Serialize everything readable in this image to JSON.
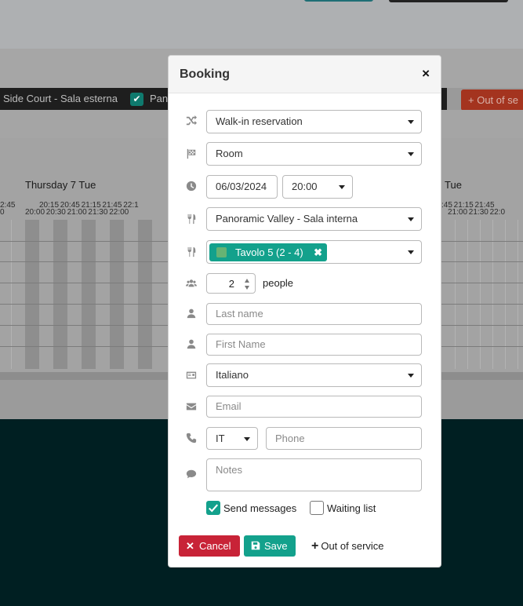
{
  "background": {
    "bar_items": [
      "Side Court - Sala esterna",
      "Pano"
    ],
    "out_of_service_button": "+ Out of se",
    "day_label_left": "Thursday 7 Tue",
    "day_label_right": "Tue",
    "times_row1_left": "2:45",
    "times_row2_left": "0",
    "times_row1": "20:15   20:45   21:15   21:45   22:1",
    "times_row2": "20:00   20:30   21:00   21:30   22:00",
    "times_right_row1": ":45   21:15   21:45",
    "times_right_row2": "21:00   21:30   22:0"
  },
  "modal": {
    "title": "Booking",
    "close_glyph": "×",
    "fields": {
      "reservation_type": "Walk-in reservation",
      "area": "Room",
      "date": "06/03/2024",
      "time": "20:00",
      "room": "Panoramic Valley - Sala interna",
      "table_chip": "Tavolo 5 (2 - 4)",
      "table_chip_remove": "✖",
      "people_count": "2",
      "people_label": "people",
      "last_name_placeholder": "Last name",
      "first_name_placeholder": "First Name",
      "language": "Italiano",
      "email_placeholder": "Email",
      "phone_country": "IT",
      "phone_placeholder": "Phone",
      "notes_placeholder": "Notes"
    },
    "options": {
      "send_messages": {
        "label": "Send messages",
        "checked": true
      },
      "waiting_list": {
        "label": "Waiting list",
        "checked": false
      }
    },
    "buttons": {
      "cancel": "Cancel",
      "cancel_icon": "✕",
      "save": "Save",
      "out_of_service": "Out of service",
      "out_of_service_icon": "+"
    },
    "icons": [
      "shuffle-icon",
      "flag-icon",
      "clock-icon",
      "cutlery-icon",
      "cutlery-icon",
      "users-icon",
      "user-icon",
      "user-icon",
      "id-card-icon",
      "envelope-icon",
      "phone-icon",
      "comment-icon"
    ],
    "colors": {
      "accent": "#13a18c",
      "cancel": "#c82337",
      "table_swatch": "#66b374"
    }
  }
}
